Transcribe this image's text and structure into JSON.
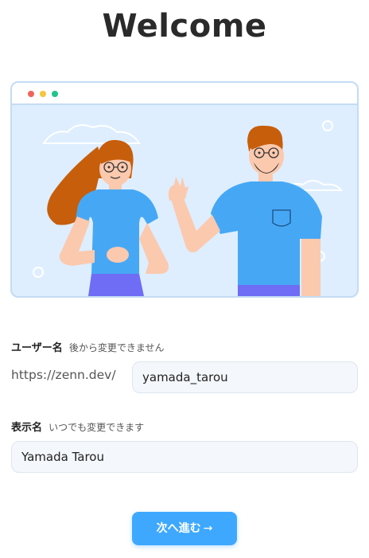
{
  "heading": "Welcome",
  "username": {
    "label": "ユーザー名",
    "hint": "後から変更できません",
    "prefix": "https://zenn.dev/",
    "value": "yamada_tarou"
  },
  "display_name": {
    "label": "表示名",
    "hint": "いつでも変更できます",
    "value": "Yamada Tarou"
  },
  "next_button": {
    "label": "次へ進む",
    "arrow": "→"
  },
  "colors": {
    "accent": "#3ea8ff",
    "illustration_bg": "#deeefe",
    "shirt": "#46a8f5",
    "pants": "#6f6cf5",
    "hair": "#c75e0b",
    "skin": "#fbc9ae"
  },
  "icons": [
    "window-dots-icon",
    "cloud-icon",
    "circle-icon"
  ]
}
